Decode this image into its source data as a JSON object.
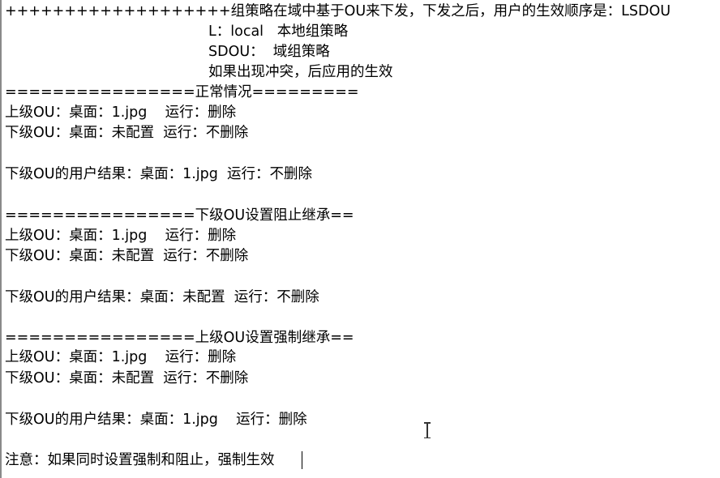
{
  "document": {
    "lines": [
      "+++++++++++++++++++组策略在域中基于OU来下发，下发之后，用户的生效顺序是：LSDOU",
      "L：local   本地组策略",
      "SDOU：  域组策略",
      "如果出现冲突，后应用的生效",
      "================正常情况=========",
      "上级OU：桌面：1.jpg    运行：删除",
      "下级OU：桌面：未配置  运行：不删除",
      "下级OU的用户结果：桌面：1.jpg  运行：不删除",
      "================下级OU设置阻止继承==",
      "上级OU：桌面：1.jpg    运行：删除",
      "下级OU：桌面：未配置  运行：不删除",
      "下级OU的用户结果：桌面：未配置  运行：不删除",
      "================上级OU设置强制继承==",
      "上级OU：桌面：1.jpg    运行：删除",
      "下级OU：桌面：未配置  运行：不删除",
      "下级OU的用户结果：桌面：1.jpg    运行：删除",
      "注意：如果同时设置强制和阻止，强制生效"
    ]
  }
}
